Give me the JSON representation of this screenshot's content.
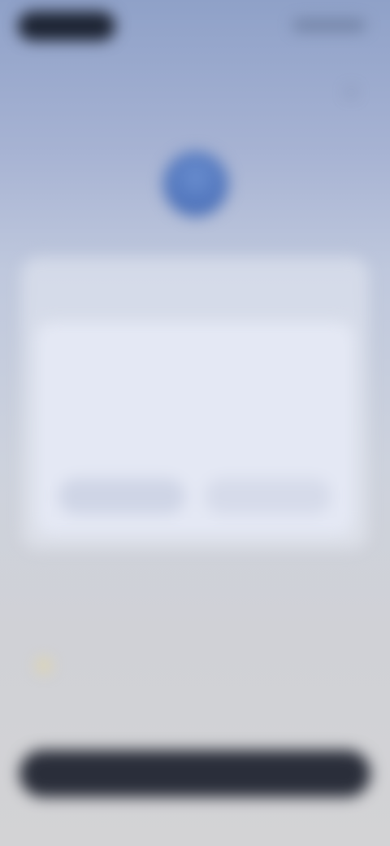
{
  "status_bar": {
    "time": "",
    "indicators": ""
  },
  "header": {
    "close_icon": "✕"
  },
  "app": {
    "icon_glyph": ""
  },
  "intro": {
    "text": ""
  },
  "dialog": {
    "title": "",
    "body": "",
    "secondary_label": "",
    "primary_label": ""
  },
  "info": {
    "title": "",
    "text": ""
  },
  "cta": {
    "label": ""
  },
  "colors": {
    "accent": "#3d62ad",
    "cta": "#2a2e3a",
    "dialog_bg": "#e4e8f4"
  }
}
